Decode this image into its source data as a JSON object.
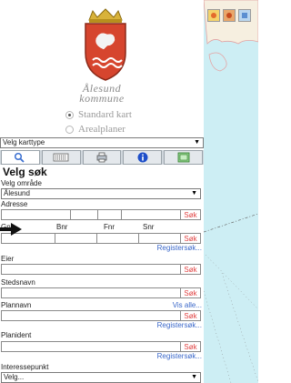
{
  "brand": {
    "line1": "Ålesund",
    "line2": "kommune"
  },
  "map_mode": {
    "options": [
      {
        "label": "Standard kart",
        "selected": true
      },
      {
        "label": "Arealplaner",
        "selected": false
      }
    ]
  },
  "karttype": {
    "value": "Velg karttype"
  },
  "toolbar": {
    "buttons": [
      {
        "icon": "search-icon",
        "active": true
      },
      {
        "icon": "layers-icon",
        "active": false
      },
      {
        "icon": "print-icon",
        "active": false
      },
      {
        "icon": "info-icon",
        "active": false
      },
      {
        "icon": "map-icon",
        "active": false
      }
    ]
  },
  "search": {
    "title": "Velg søk",
    "area_label": "Velg område",
    "area_value": "Ålesund",
    "address_label": "Adresse",
    "gnr_label": "Gnr",
    "bnr_label": "Bnr",
    "fnr_label": "Fnr",
    "snr_label": "Snr",
    "owner_label": "Eier",
    "place_label": "Stedsnavn",
    "plan_name_label": "Plannavn",
    "plan_id_label": "Planident",
    "poi_label": "Interessepunkt",
    "poi_value": "Velg...",
    "search_btn": "Søk",
    "register_link": "Registersøk...",
    "show_all_link": "Vis alle..."
  }
}
